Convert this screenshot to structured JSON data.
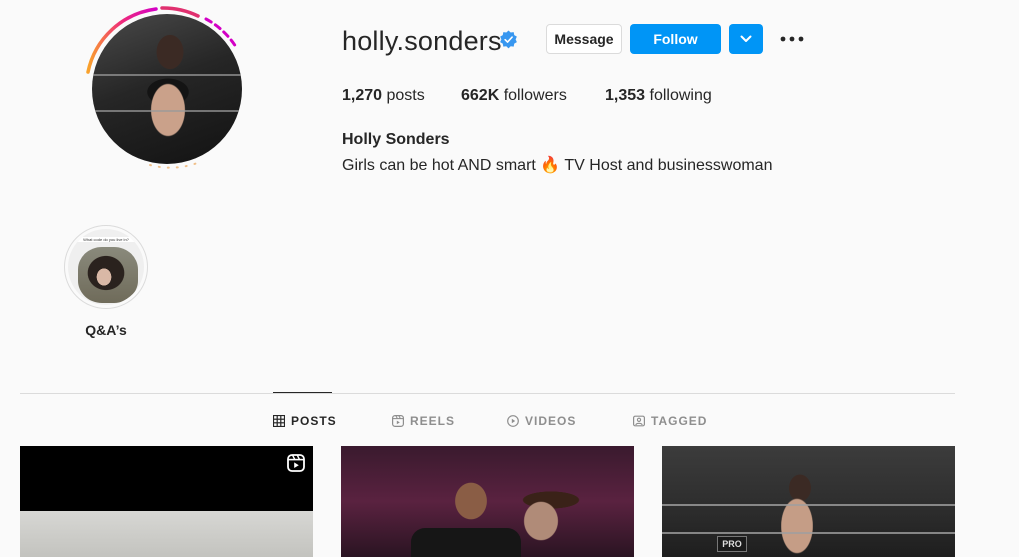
{
  "profile": {
    "username": "holly.sonders",
    "verified_icon": "verified-badge-icon",
    "full_name": "Holly Sonders",
    "bio_before_emoji": "Girls can be hot AND smart ",
    "bio_emoji": "🔥",
    "bio_after_emoji": " TV Host and businesswoman"
  },
  "actions": {
    "message_label": "Message",
    "follow_label": "Follow",
    "dropdown_icon": "chevron-down-icon",
    "more_icon": "more-options-icon"
  },
  "stats": {
    "posts_count": "1,270",
    "posts_label": "posts",
    "followers_count": "662K",
    "followers_label": "followers",
    "following_count": "1,353",
    "following_label": "following"
  },
  "highlights": [
    {
      "label": "Q&A’s",
      "caption": "What code do you live in?"
    }
  ],
  "tabs": [
    {
      "label": "POSTS",
      "icon": "grid-icon",
      "active": true
    },
    {
      "label": "REELS",
      "icon": "reels-icon",
      "active": false
    },
    {
      "label": "VIDEOS",
      "icon": "video-play-icon",
      "active": false
    },
    {
      "label": "TAGGED",
      "icon": "tagged-icon",
      "active": false
    }
  ],
  "posts": [
    {
      "type": "reel",
      "badge_icon": "reel-badge-icon"
    },
    {
      "type": "photo"
    },
    {
      "type": "photo",
      "sign_text": "PRO"
    }
  ],
  "colors": {
    "accent": "#0095f6",
    "background": "#fafafa",
    "text": "#262626",
    "muted": "#8e8e8e",
    "border": "#dbdbdb",
    "story_ring_start": "#f9a32a",
    "story_ring_end": "#d300c5"
  }
}
